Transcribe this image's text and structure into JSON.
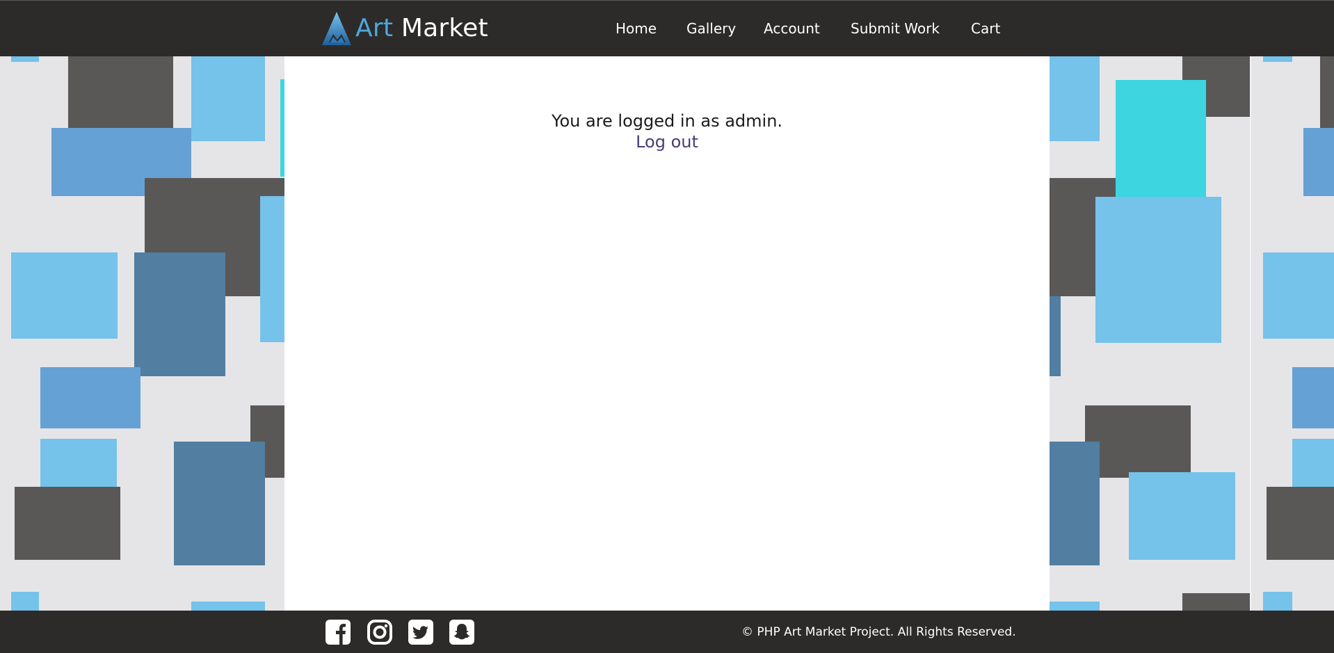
{
  "header": {
    "logo": {
      "word1": "Art",
      "word2": "Market",
      "icon": "art-market-logo-icon"
    },
    "nav": [
      {
        "label": "Home"
      },
      {
        "label": "Gallery"
      },
      {
        "label": "Account"
      },
      {
        "label": "Submit Work"
      },
      {
        "label": "Cart"
      }
    ]
  },
  "main": {
    "status_text": "You are logged in as admin.",
    "logout_label": "Log out"
  },
  "footer": {
    "social": [
      {
        "icon": "facebook-icon"
      },
      {
        "icon": "instagram-icon"
      },
      {
        "icon": "twitter-icon"
      },
      {
        "icon": "snapchat-icon"
      }
    ],
    "copyright": "© PHP Art Market Project. All Rights Reserved."
  },
  "colors": {
    "header_bg": "#2c2b29",
    "footer_bg": "#2c2b29",
    "accent": "#4da8df",
    "link": "#4b3a7a",
    "page_bg": "#e5e5e8",
    "tile_gray": "#595857",
    "tile_light_blue": "#75c2ea",
    "tile_mid_blue": "#65a1d4",
    "tile_dark_blue": "#517ea1",
    "tile_turquoise": "#3cd5e0"
  }
}
